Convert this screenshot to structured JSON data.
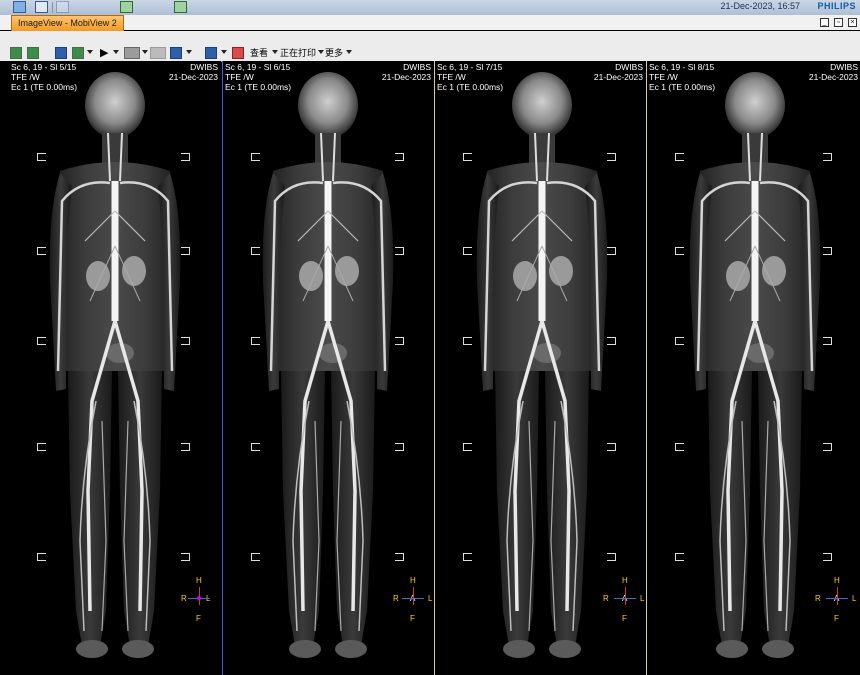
{
  "top_bar": {
    "datetime": "21-Dec-2023, 16:57",
    "brand": "PHILIPS",
    "icons": [
      "layout-icon",
      "folder-icon",
      "tools-icon",
      "monitor-icon",
      "transfer-icon"
    ]
  },
  "tab": {
    "label": "ImageView - MobiView 2"
  },
  "window_controls": [
    "minimize-icon",
    "restore-icon",
    "close-icon"
  ],
  "toolbar": {
    "view_label": "查看",
    "print_label": "正在打印",
    "more_label": "更多",
    "icons": [
      "grid-1-icon",
      "grid-2-icon",
      "grid-3-icon",
      "grid-4-icon",
      "play-icon",
      "film-icon",
      "measure-icon",
      "pin-icon",
      "edit-icon",
      "reset-icon"
    ]
  },
  "viewports": [
    {
      "series": "Sc 6, 19 - Sl 5/15",
      "sequence": "TFE   /W",
      "echo": "Ec 1 (TE 0.00ms)",
      "protocol": "DWIBS",
      "date": "21-Dec-2023",
      "orient": {
        "top": "H",
        "left": "R",
        "center": "A",
        "right": "L",
        "bottom": "F"
      }
    },
    {
      "series": "Sc 6, 19 - Sl 6/15",
      "sequence": "TFE   /W",
      "echo": "Ec 1 (TE 0.00ms)",
      "protocol": "DWIBS",
      "date": "21-Dec-2023",
      "orient": {
        "top": "H",
        "left": "R",
        "center": "A",
        "right": "L",
        "bottom": "F"
      }
    },
    {
      "series": "Sc 6, 19 - Sl 7/15",
      "sequence": "TFE   /W",
      "echo": "Ec 1 (TE 0.00ms)",
      "protocol": "DWIBS",
      "date": "21-Dec-2023",
      "orient": {
        "top": "H",
        "left": "R",
        "center": "A",
        "right": "L",
        "bottom": "F"
      }
    },
    {
      "series": "Sc 6, 19 - Sl 8/15",
      "sequence": "TFE   /W",
      "echo": "Ec 1 (TE 0.00ms)",
      "protocol": "DWIBS",
      "date": "21-Dec-2023",
      "orient": {
        "top": "H",
        "left": "R",
        "center": "A",
        "right": "L",
        "bottom": "F"
      }
    }
  ]
}
